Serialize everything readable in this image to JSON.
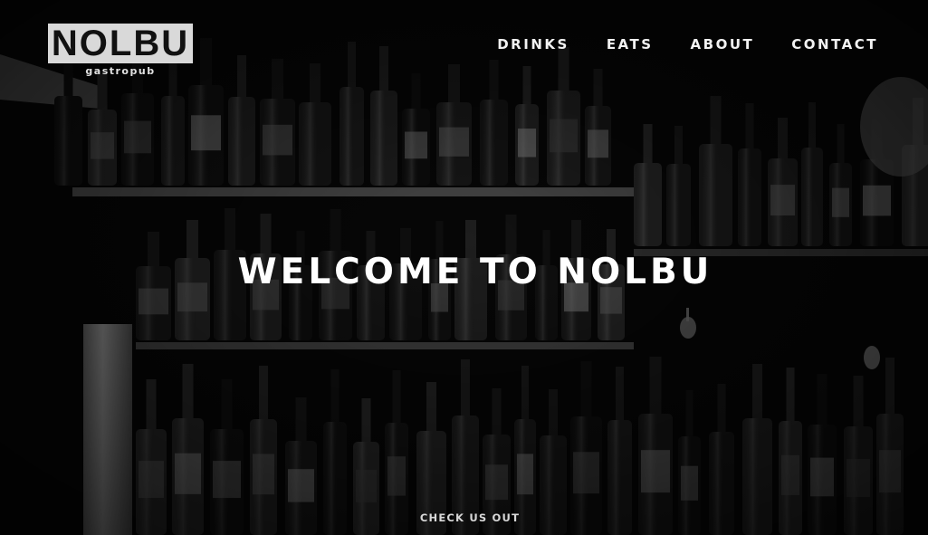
{
  "brand": {
    "name": "NOLBU",
    "tagline": "gastropub"
  },
  "nav": {
    "items": [
      {
        "label": "DRINKS"
      },
      {
        "label": "EATS"
      },
      {
        "label": "ABOUT"
      },
      {
        "label": "CONTACT"
      }
    ]
  },
  "hero": {
    "headline": "WELCOME TO NOLBU",
    "cta_label": "CHECK US OUT",
    "background_image": "bar-shelves-with-beer-bottles"
  },
  "colors": {
    "text": "#ffffff",
    "logo_background": "#d9d9d9",
    "logo_text": "#111111",
    "overlay": "#000000"
  }
}
